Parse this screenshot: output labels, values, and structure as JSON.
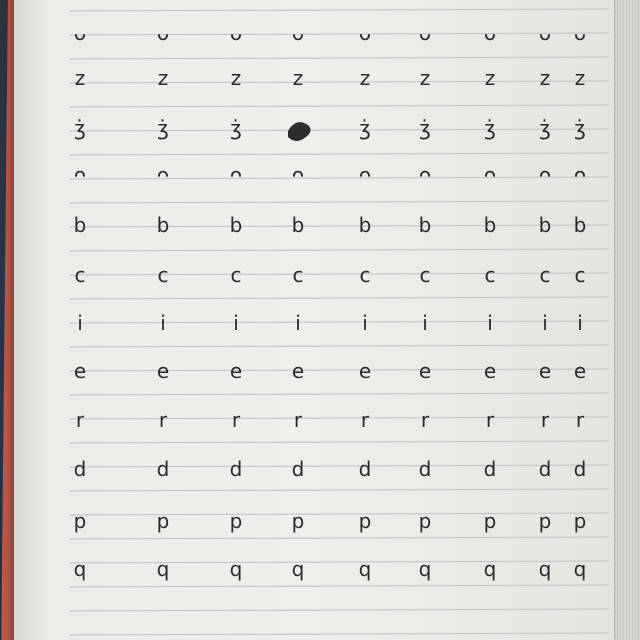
{
  "image": {
    "subject": "handwriting-practice-notebook",
    "colors": {
      "paper": "#efefeb",
      "ruled_line": "#bfc2c4",
      "ink": "#2a2a2a",
      "cover": "#b8574a",
      "desk": "#23364f"
    },
    "rows": [
      {
        "letter": "u",
        "glyphs": [
          "ᴗ",
          "ᴗ",
          "ᴗ",
          "ᴗ",
          "ᴗ",
          "ᴗ",
          "ᴗ",
          "ᴗ",
          "ᴗ"
        ]
      },
      {
        "letter": "z",
        "glyphs": [
          "z",
          "z",
          "z",
          "z",
          "z",
          "z",
          "z",
          "z",
          "z"
        ]
      },
      {
        "letter": "ʒ",
        "glyphs": [
          "ʒ̇",
          "ʒ̇",
          "ʒ̇",
          "",
          "ʒ̇",
          "ʒ̇",
          "ʒ̇",
          "ʒ̇",
          "ʒ̇"
        ]
      },
      {
        "letter": "n",
        "glyphs": [
          "ᴖ",
          "ᴖ",
          "ᴖ",
          "ᴖ",
          "ᴖ",
          "ᴖ",
          "ᴖ",
          "ᴖ",
          "ᴖ"
        ]
      },
      {
        "letter": "b",
        "glyphs": [
          "b",
          "b",
          "b",
          "b",
          "b",
          "b",
          "b",
          "b",
          "b"
        ]
      },
      {
        "letter": "c",
        "glyphs": [
          "c",
          "c",
          "c",
          "c",
          "c",
          "c",
          "c",
          "c",
          "c"
        ]
      },
      {
        "letter": "i",
        "glyphs": [
          "i",
          "i",
          "i",
          "i",
          "i",
          "i",
          "i",
          "i",
          "i"
        ]
      },
      {
        "letter": "e",
        "glyphs": [
          "e",
          "e",
          "e",
          "e",
          "e",
          "e",
          "e",
          "e",
          "e"
        ]
      },
      {
        "letter": "r",
        "glyphs": [
          "r",
          "r",
          "r",
          "r",
          "r",
          "r",
          "r",
          "r",
          "r"
        ]
      },
      {
        "letter": "d",
        "glyphs": [
          "d",
          "d",
          "d",
          "d",
          "d",
          "d",
          "d",
          "d",
          "d"
        ]
      },
      {
        "letter": "p",
        "glyphs": [
          "p",
          "p",
          "p",
          "p",
          "p",
          "p",
          "p",
          "p",
          "p"
        ]
      },
      {
        "letter": "q",
        "glyphs": [
          "q",
          "q",
          "q",
          "q",
          "q",
          "q",
          "q",
          "q",
          "q"
        ]
      }
    ],
    "scribbled_out": {
      "row": 2,
      "column": 3
    }
  }
}
